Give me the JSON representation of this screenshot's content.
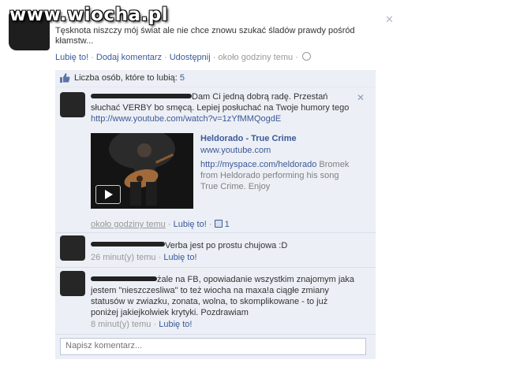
{
  "watermark": "www.wiocha.pl",
  "post": {
    "text": "Tęsknota niszczy mój świat ale nie chce znowu szukać śladów prawdy pośród kłamstw...",
    "actions": {
      "like": "Lubię to!",
      "comment": "Dodaj komentarz",
      "share": "Udostępnij",
      "time": "około godziny temu"
    },
    "close_icon": "close-icon"
  },
  "likes": {
    "label": "Liczba osób, które to lubią:",
    "count": "5"
  },
  "comments": [
    {
      "text": "Dam Ci jedną dobrą radę. Przestań słuchać VERBY bo smęcą. Lepiej posłuchać na Twoje humory tego",
      "link": "http://www.youtube.com/watch?v=1zYfMMQogdE",
      "attachment": {
        "title": "Heldorado - True Crime",
        "domain": "www.youtube.com",
        "desc_link": "http://myspace.com/heldorado",
        "desc": "Bromek from Heldorado performing his song True Crime. Enjoy"
      },
      "time": "około godziny temu",
      "like": "Lubię to!",
      "like_count": "1"
    },
    {
      "text": "Verba jest po prostu chujowa :D",
      "time": "26 minut(y) temu",
      "like": "Lubię to!"
    },
    {
      "text_line1": "żale na FB, opowiadanie wszystkim znajomym jaka",
      "text_rest": "jestem \"nieszczesliwa\" to też wiocha na maxa!a ciągłe zmiany statusów w zwiazku, zonata, wolna, to skomplikowane - to już poniżej jakiejkolwiek krytyki. Pozdrawiam",
      "time": "8 minut(y) temu",
      "like": "Lubię to!"
    }
  ],
  "composer": {
    "placeholder": "Napisz komentarz..."
  }
}
